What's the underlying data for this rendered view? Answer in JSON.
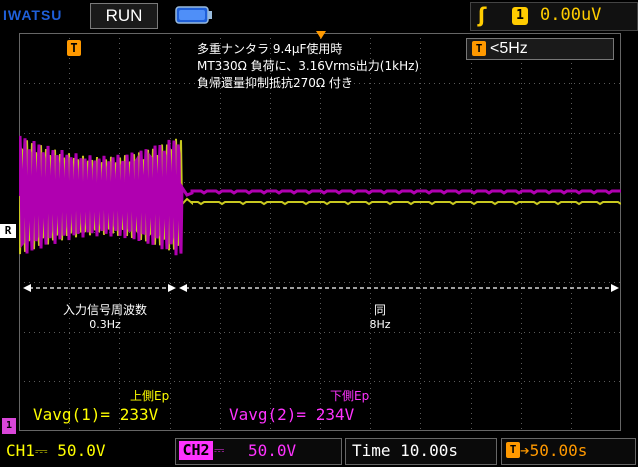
{
  "topbar": {
    "brand": "IWATSU",
    "run_state": "RUN",
    "trigger_slope_icon": "rising-edge-icon",
    "trigger_source": "1",
    "trigger_level": "0.00uV",
    "colors": {
      "trigger": "#ffcc00",
      "brand": "#1f5fd8"
    }
  },
  "screen": {
    "marker_T": "T",
    "ref_marker": "R",
    "ch_marker": "1",
    "filter": {
      "icon": "T",
      "label": "<5Hz"
    },
    "notes": [
      "多重ナンタラ 9.4μF使用時",
      "MT330Ω 負荷に、3.16Vrms出力(1kHz)",
      "負帰還量抑制抵抗270Ω 付き"
    ],
    "left_segment": {
      "label": "入力信号周波数",
      "freq": "0.3Hz"
    },
    "right_segment": {
      "label": "同",
      "freq": "8Hz"
    },
    "upper_ep_label": "上側Ep",
    "lower_ep_label": "下側Ep",
    "meas1": "Vavg(1)= 233V",
    "meas2": "Vavg(2)= 234V",
    "colors": {
      "ch1": "#c8c820",
      "ch2": "#b000b0",
      "grid": "#5a5a5a"
    }
  },
  "bottombar": {
    "ch1": "CH1⎓  50.0V",
    "ch2_name": "CH2",
    "ch2_sym": "⎓",
    "ch2_val": "50.0V",
    "time": "Time 10.00s",
    "delay_icon": "T",
    "delay": "➔50.00s"
  }
}
